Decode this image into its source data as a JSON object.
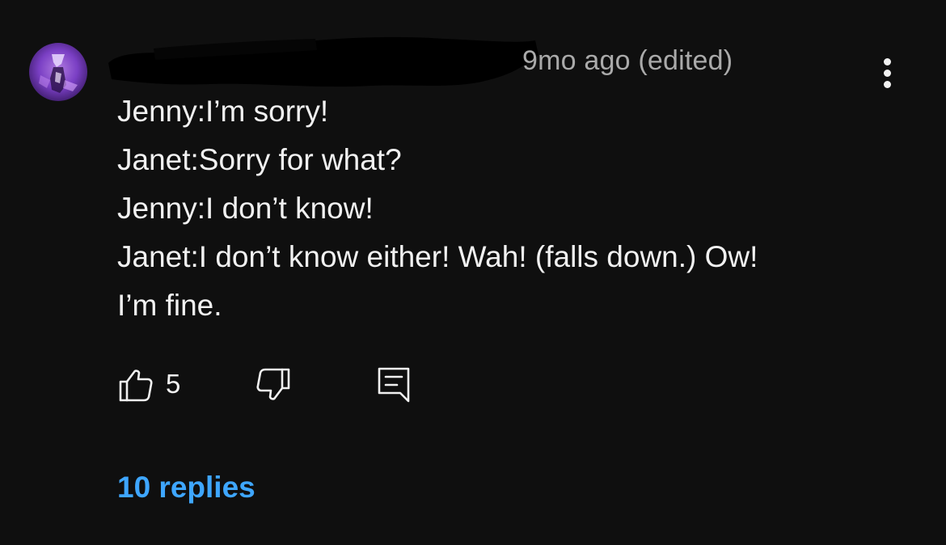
{
  "comment": {
    "author_avatar_icon": "user-avatar-icon",
    "timestamp": "9mo ago (edited)",
    "lines": [
      "Jenny:I’m sorry!",
      "Janet:Sorry for what?",
      "Jenny:I don’t know!",
      "Janet:I don’t know either! Wah! (falls down.) Ow!",
      "I’m fine."
    ],
    "actions": {
      "like_icon": "thumbs-up-icon",
      "like_count": "5",
      "dislike_icon": "thumbs-down-icon",
      "reply_icon": "reply-comment-icon"
    },
    "replies_label": "10 replies",
    "more_icon": "more-vertical-icon"
  },
  "colors": {
    "background": "#0f0f0f",
    "text": "#f1f1f1",
    "secondary_text": "#aaaaaa",
    "link": "#3ea6ff",
    "avatar_accent": "#7a3fc4"
  }
}
